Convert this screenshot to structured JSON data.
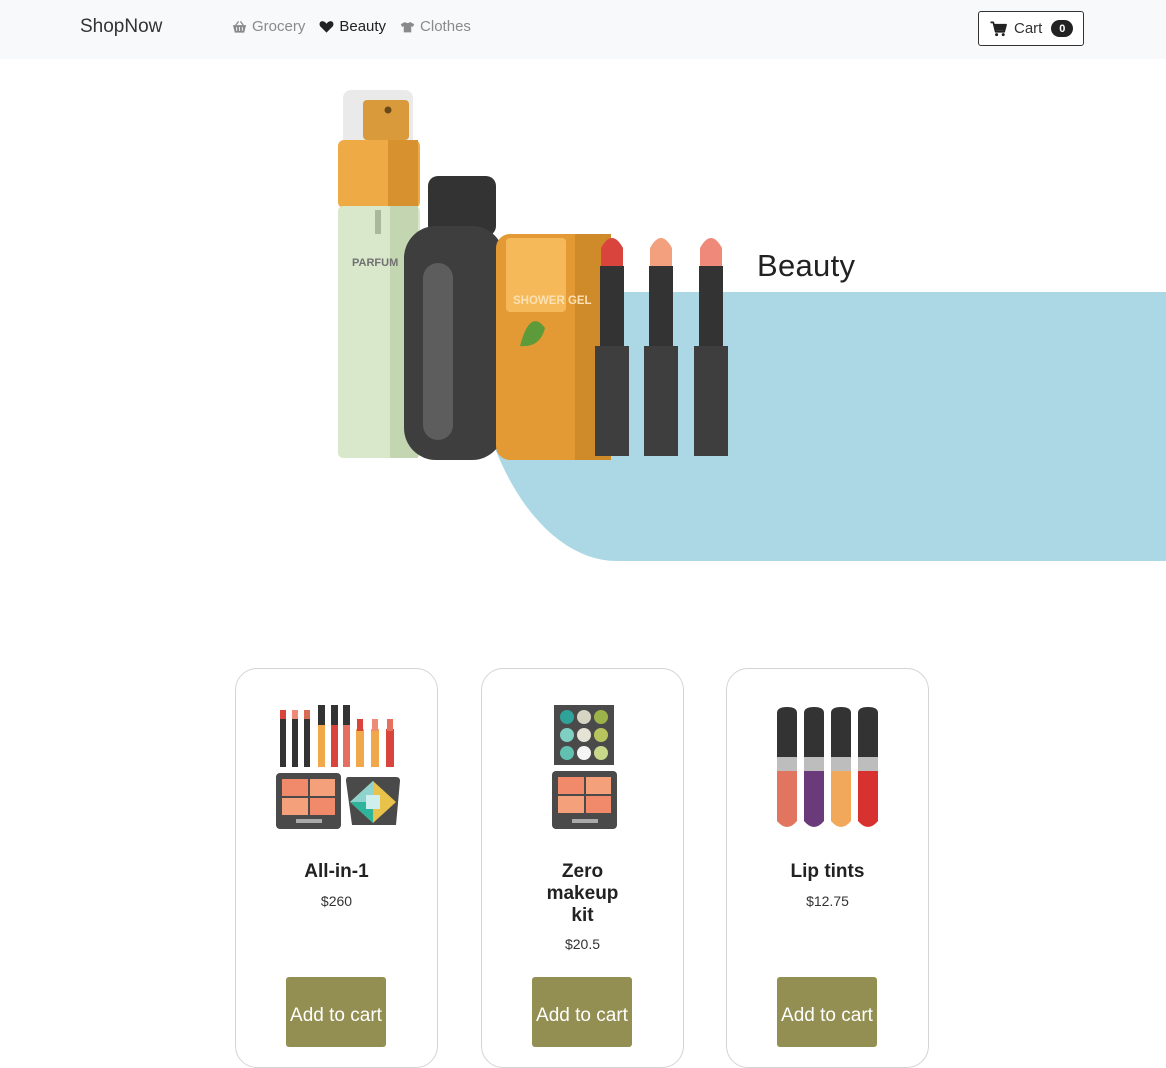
{
  "navbar": {
    "brand": "ShopNow",
    "links": [
      {
        "label": "Grocery",
        "icon": "basket-icon",
        "active": false
      },
      {
        "label": "Beauty",
        "icon": "heart-icon",
        "active": true
      },
      {
        "label": "Clothes",
        "icon": "tshirt-icon",
        "active": false
      }
    ],
    "cart": {
      "label": "Cart",
      "count": "0",
      "icon": "cart-icon"
    }
  },
  "hero": {
    "title": "Beauty",
    "illustration": {
      "perfume_label": "PARFUM",
      "gel_label": "SHOWER GEL"
    },
    "accent_color": "#acd8e5"
  },
  "products": [
    {
      "name": "All-in-1",
      "price": "$260",
      "button": "Add to cart",
      "image": "makeup-set-image"
    },
    {
      "name": "Zero makeup kit",
      "price": "$20.5",
      "button": "Add to cart",
      "image": "eyeshadow-kit-image"
    },
    {
      "name": "Lip tints",
      "price": "$12.75",
      "button": "Add to cart",
      "image": "lip-tints-image"
    }
  ],
  "colors": {
    "button": "#938f52",
    "navbar_bg": "#f8f9fa"
  }
}
